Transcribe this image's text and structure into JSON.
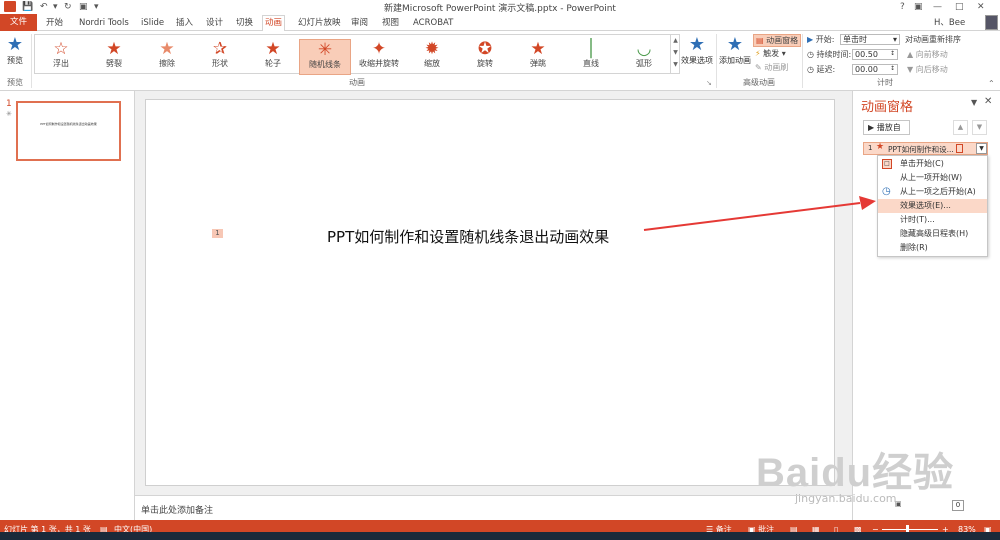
{
  "window": {
    "title": "新建Microsoft PowerPoint 演示文稿.pptx - PowerPoint",
    "user": "H、Bee",
    "help": "?"
  },
  "tabs": [
    "文件",
    "开始",
    "Nordri Tools",
    "iSlide",
    "插入",
    "设计",
    "切换",
    "动画",
    "幻灯片放映",
    "审阅",
    "视图",
    "ACROBAT"
  ],
  "active_tab": "动画",
  "ribbon": {
    "preview": {
      "button": "预览",
      "group": "预览"
    },
    "animations": {
      "group": "动画",
      "items": [
        "浮出",
        "劈裂",
        "擦除",
        "形状",
        "轮子",
        "随机线条",
        "收缩并旋转",
        "缩放",
        "旋转",
        "弹跳",
        "直线",
        "弧形"
      ],
      "selected": "随机线条"
    },
    "effect_options": "效果选项",
    "advanced": {
      "group": "高级动画",
      "add_animation": "添加动画",
      "animation_pane": "动画窗格",
      "trigger": "触发",
      "painter": "动画刷"
    },
    "timing": {
      "group": "计时",
      "start_label": "开始:",
      "start_value": "单击时",
      "duration_label": "持续时间:",
      "duration_value": "00.50",
      "delay_label": "延迟:",
      "delay_value": "00.00",
      "reorder": "对动画重新排序",
      "move_earlier": "向前移动",
      "move_later": "向后移动"
    }
  },
  "thumbnail": {
    "number": "1",
    "text": "PPT如何制作和设置随机线条退出动画效果"
  },
  "slide": {
    "tag": "1",
    "text": "PPT如何制作和设置随机线条退出动画效果"
  },
  "notes_placeholder": "单击此处添加备注",
  "animation_pane": {
    "title": "动画窗格",
    "play_button": "播放自",
    "item_index": "1",
    "item_label": "PPT如何制作和设...",
    "menu": [
      "单击开始(C)",
      "从上一项开始(W)",
      "从上一项之后开始(A)",
      "效果选项(E)...",
      "计时(T)...",
      "隐藏高级日程表(H)",
      "删除(R)"
    ],
    "highlighted_menu_item": "效果选项(E)..."
  },
  "status": {
    "slide_info": "幻灯片 第 1 张，共 1 张",
    "language": "中文(中国)",
    "notes": "备注",
    "comments": "批注",
    "zoom": "83%"
  },
  "watermark": {
    "brand": "Baidu经验",
    "url": "jingyan.baidu.com"
  },
  "colors": {
    "accent": "#d24726",
    "highlight": "#fbd8c8",
    "arrow": "#e53935"
  }
}
